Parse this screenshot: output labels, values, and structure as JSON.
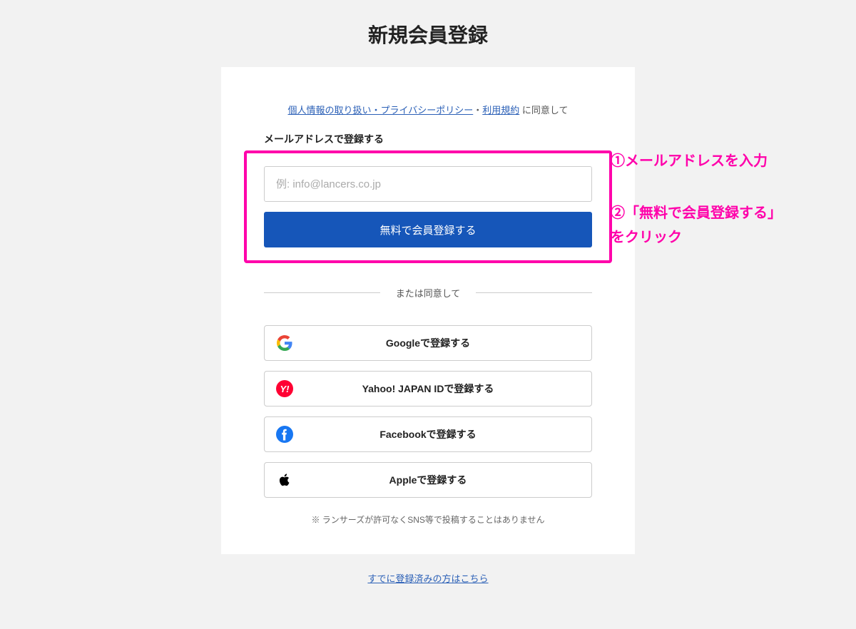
{
  "page_title": "新規会員登録",
  "consent": {
    "link_privacy": "個人情報の取り扱い・プライバシーポリシー",
    "separator": "・",
    "link_terms": "利用規約",
    "tail": " に同意して"
  },
  "email_section": {
    "label": "メールアドレスで登録する",
    "input_placeholder": "例: info@lancers.co.jp",
    "register_button": "無料で会員登録する"
  },
  "divider_text": "または同意して",
  "social": {
    "google": "Googleで登録する",
    "yahoo": "Yahoo! JAPAN IDで登録する",
    "facebook": "Facebookで登録する",
    "apple": "Appleで登録する"
  },
  "disclaimer": "※ ランサーズが許可なくSNS等で投稿することはありません",
  "footer_link": "すでに登録済みの方はこちら",
  "annotations": {
    "step1": "①メールアドレスを入力",
    "step2": "②「無料で会員登録する」\nをクリック"
  },
  "colors": {
    "highlight": "#ff00aa",
    "primary_button": "#1656b9",
    "link": "#2b60b7",
    "yahoo_red": "#ff0033",
    "facebook_blue": "#1877f2"
  }
}
